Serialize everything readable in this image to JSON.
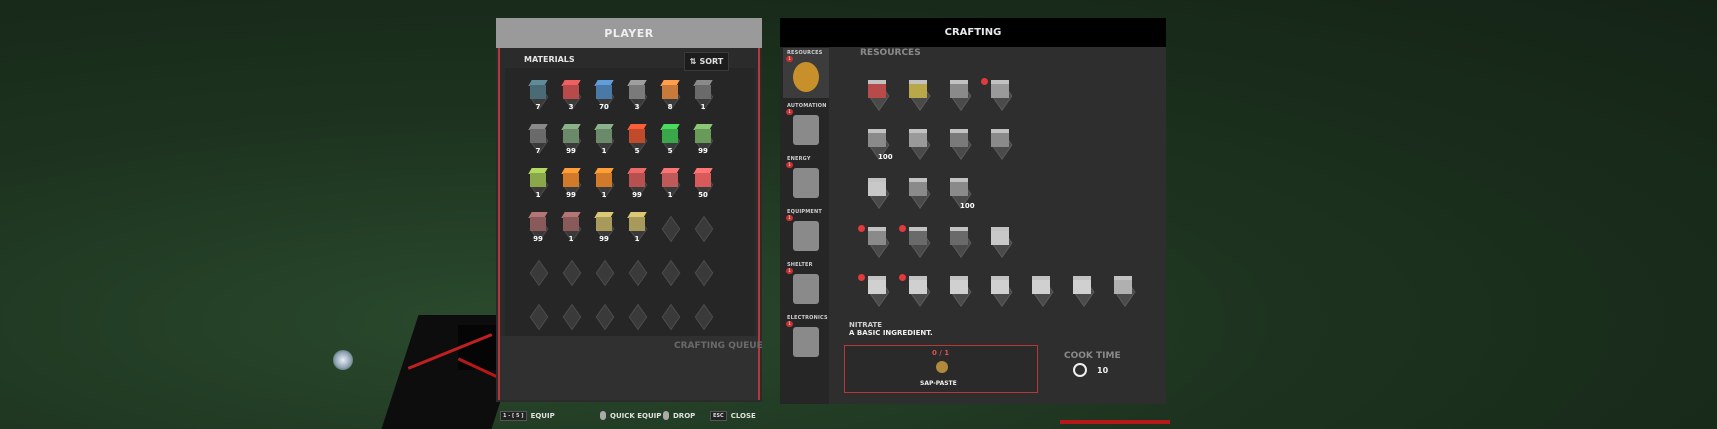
{
  "player": {
    "title": "PLAYER",
    "materials_title": "MATERIALS",
    "sort_label": "SORT",
    "crafting_queue_label": "CRAFTING QUEUE",
    "inventory": [
      [
        {
          "color": "#4a6b76",
          "count": "7"
        },
        {
          "color": "#b84a4a",
          "count": "3"
        },
        {
          "color": "#4a79a8",
          "count": "70"
        },
        {
          "color": "#7a7a7a",
          "count": "3"
        },
        {
          "color": "#c87a3a",
          "count": "8"
        },
        {
          "color": "#6a6a6a",
          "count": "1"
        }
      ],
      [
        {
          "color": "#6a6a6a",
          "count": "7"
        },
        {
          "color": "#6a8a6a",
          "count": "99"
        },
        {
          "color": "#6a8a6a",
          "count": "1"
        },
        {
          "color": "#c04a2a",
          "count": "5"
        },
        {
          "color": "#3aa84a",
          "count": "5"
        },
        {
          "color": "#6a9a5a",
          "count": "99"
        }
      ],
      [
        {
          "color": "#8aa84a",
          "count": "1"
        },
        {
          "color": "#d07a2a",
          "count": "99"
        },
        {
          "color": "#d07a2a",
          "count": "1"
        },
        {
          "color": "#b85050",
          "count": "99"
        },
        {
          "color": "#c05a5a",
          "count": "1"
        },
        {
          "color": "#d85a5a",
          "count": "50"
        }
      ],
      [
        {
          "color": "#8a5a5a",
          "count": "99"
        },
        {
          "color": "#8a5a5a",
          "count": "1"
        },
        {
          "color": "#a89a5a",
          "count": "99"
        },
        {
          "color": "#a89a5a",
          "count": "1"
        },
        {
          "color": "",
          "count": ""
        },
        {
          "color": "",
          "count": ""
        }
      ],
      [
        {
          "color": "",
          "count": ""
        },
        {
          "color": "",
          "count": ""
        },
        {
          "color": "",
          "count": ""
        },
        {
          "color": "",
          "count": ""
        },
        {
          "color": "",
          "count": ""
        },
        {
          "color": "",
          "count": ""
        }
      ],
      [
        {
          "color": "",
          "count": ""
        },
        {
          "color": "",
          "count": ""
        },
        {
          "color": "",
          "count": ""
        },
        {
          "color": "",
          "count": ""
        },
        {
          "color": "",
          "count": ""
        },
        {
          "color": "",
          "count": ""
        }
      ]
    ]
  },
  "crafting": {
    "title": "CRAFTING",
    "section_title": "RESOURCES",
    "categories": [
      {
        "label": "RESOURCES",
        "badge": "1"
      },
      {
        "label": "AUTOMATION",
        "badge": "1"
      },
      {
        "label": "ENERGY",
        "badge": "1"
      },
      {
        "label": "EQUIPMENT",
        "badge": "1"
      },
      {
        "label": "SHELTER",
        "badge": "1"
      },
      {
        "label": "ELECTRONICS",
        "badge": "1"
      }
    ],
    "recipes": [
      [
        {
          "num": "",
          "dot": false,
          "color": "#b84a4a"
        },
        {
          "num": "",
          "dot": false,
          "color": "#b8a84a"
        },
        {
          "num": "",
          "dot": false,
          "color": "#8a8a8a"
        },
        {
          "num": "",
          "dot": true,
          "color": "#9a9a9a"
        }
      ],
      [
        {
          "num": "100",
          "dot": false,
          "color": "#8a8a8a"
        },
        {
          "num": "",
          "dot": false,
          "color": "#9a9a9a"
        },
        {
          "num": "",
          "dot": false,
          "color": "#7a7a7a"
        },
        {
          "num": "",
          "dot": false,
          "color": "#8a8a8a"
        }
      ],
      [
        {
          "num": "",
          "dot": false,
          "color": "#c8c8c8"
        },
        {
          "num": "",
          "dot": false,
          "color": "#8a8a8a"
        },
        {
          "num": "100",
          "dot": false,
          "color": "#8a8a8a"
        }
      ],
      [
        {
          "num": "",
          "dot": true,
          "color": "#8a8a8a"
        },
        {
          "num": "",
          "dot": true,
          "color": "#6a6a6a"
        },
        {
          "num": "",
          "dot": false,
          "color": "#6a6a6a"
        },
        {
          "num": "",
          "dot": false,
          "color": "#c8c8c8"
        }
      ],
      [
        {
          "num": "",
          "dot": true,
          "color": "#d0d0d0"
        },
        {
          "num": "",
          "dot": true,
          "color": "#d0d0d0"
        },
        {
          "num": "",
          "dot": false,
          "color": "#d0d0d0"
        },
        {
          "num": "",
          "dot": false,
          "color": "#d0d0d0"
        },
        {
          "num": "",
          "dot": false,
          "color": "#d0d0d0"
        },
        {
          "num": "",
          "dot": false,
          "color": "#d0d0d0"
        },
        {
          "num": "",
          "dot": false,
          "color": "#b0b0b0"
        }
      ]
    ],
    "selected": {
      "name": "NITRATE",
      "description": "A BASIC INGREDIENT.",
      "ingredient_count": "0 / 1",
      "ingredient_name": "SAP-PASTE",
      "cook_time_label": "COOK TIME",
      "cook_time_value": "10"
    }
  },
  "hints": {
    "equip_key": "1 - [ 5 ]",
    "equip_label": "EQUIP",
    "quick_equip_label": "QUICK EQUIP",
    "drop_label": "DROP",
    "close_key": "ESC",
    "close_label": "CLOSE"
  }
}
